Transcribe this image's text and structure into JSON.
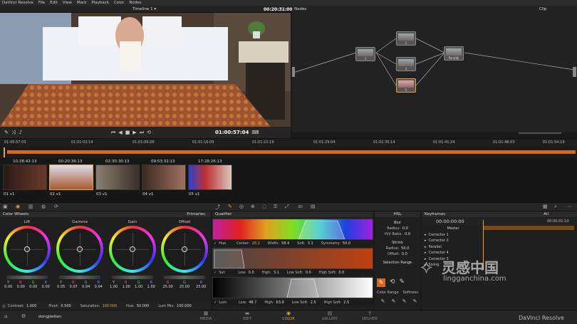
{
  "menu": {
    "app": "DaVinci Resolve",
    "items": [
      "File",
      "Edit",
      "View",
      "Mark",
      "Playback",
      "Color",
      "Nodes"
    ]
  },
  "viewer": {
    "timeline_name": "Timeline 1",
    "timecode_top": "00:20:31:00",
    "timecode_current": "01:00:57:04"
  },
  "nodes": {
    "title": "Nodes",
    "mode": "Clip",
    "node_labels": [
      "1",
      "2",
      "3",
      "4",
      "5"
    ],
    "parallel_label": "Parallel"
  },
  "ruler": {
    "ticks": [
      "01:00:57:03",
      "01:01:03:14",
      "01:01:09:26",
      "01:01:16:09",
      "01:01:22:19",
      "01:01:29:04",
      "01:01:35:14",
      "01:01:41:24",
      "01:01:48:03",
      "01:01:54:19"
    ]
  },
  "clips": [
    {
      "tc": "10:28:42:13",
      "label": "01",
      "track": "v1"
    },
    {
      "tc": "00:20:36:13",
      "label": "02",
      "track": "v1"
    },
    {
      "tc": "02:30:30:13",
      "label": "03",
      "track": "v1"
    },
    {
      "tc": "09:53:32:13",
      "label": "04",
      "track": "v1"
    },
    {
      "tc": "17:28:26:13",
      "label": "05",
      "track": "v1"
    }
  ],
  "color_wheels": {
    "title": "Color Wheels",
    "mode": "Primaries",
    "wheels": [
      {
        "name": "Lift",
        "channels": [
          "Y",
          "R",
          "G",
          "B"
        ],
        "values": [
          "0.00",
          "0.00",
          "0.00",
          "0.00"
        ]
      },
      {
        "name": "Gamma",
        "channels": [
          "Y",
          "R",
          "G",
          "B"
        ],
        "values": [
          "0.05",
          "0.07",
          "0.04",
          "0.04"
        ]
      },
      {
        "name": "Gain",
        "channels": [
          "Y",
          "R",
          "G",
          "B"
        ],
        "values": [
          "1.00",
          "1.00",
          "1.00",
          "1.00"
        ]
      },
      {
        "name": "Offset",
        "channels": [
          "R",
          "G",
          "B"
        ],
        "values": [
          "25.00",
          "25.00",
          "25.00"
        ]
      }
    ],
    "footer": {
      "contrast_label": "Contrast:",
      "contrast_val": "1.000",
      "pivot_label": "Pivot:",
      "pivot_val": "0.500",
      "saturation_label": "Saturation:",
      "saturation_val": "100.000",
      "hue_label": "Hue:",
      "hue_val": "50.000",
      "lummix_label": "Lum Mix:",
      "lummix_val": "100.000"
    }
  },
  "qualifier": {
    "title": "Qualifier",
    "hue": {
      "label": "Hue",
      "center_label": "Center:",
      "center": "28.2",
      "width_label": "Width:",
      "width": "58.4",
      "soft_label": "Soft:",
      "soft": "3.1",
      "sym_label": "Symmetry:",
      "sym": "50.0"
    },
    "sat": {
      "label": "Sat",
      "low_label": "Low:",
      "low": "0.0",
      "high_label": "High:",
      "high": "3.1",
      "lowsoft_label": "Low Soft:",
      "lowsoft": "0.0",
      "highsoft_label": "High Soft:",
      "highsoft": "0.0"
    },
    "lum": {
      "label": "Lum",
      "low_label": "Low:",
      "low": "48.7",
      "high_label": "High:",
      "high": "63.9",
      "lowsoft_label": "Low Soft:",
      "lowsoft": "2.5",
      "highsoft_label": "High Soft:",
      "highsoft": "2.5"
    }
  },
  "hsl": {
    "title": "HSL",
    "blur_title": "Blur",
    "radius_label": "Radius:",
    "radius": "0.0",
    "hv_label": "H/V Ratio:",
    "hv": "0.0",
    "shrink_title": "Shrink",
    "radius2_label": "Radius:",
    "radius2": "50.0",
    "offset_label": "Offset:",
    "offset": "0.0",
    "selection_range": "Selection Range",
    "color_range": "Color Range",
    "softness": "Softness"
  },
  "keyframes": {
    "title": "Keyframes",
    "filter": "All",
    "tc_left": "00:00:00:00",
    "tc_right": "00:00:01:10",
    "rows": [
      "Master",
      "Corrector 1",
      "Corrector 2",
      "Parallel",
      "Corrector 4",
      "Corrector 3",
      "Sizing"
    ]
  },
  "bottom": {
    "user": "dengjiedian",
    "pages": [
      "MEDIA",
      "EDIT",
      "COLOR",
      "GALLERY",
      "DELIVER"
    ],
    "brand": "DaVinci Resolve"
  },
  "watermark": {
    "cn": "灵感中国",
    "url": "lingganchina.com"
  },
  "colors": {
    "accent": "#e8a23c",
    "panel": "#1f1f1f",
    "timeline_orange": "#d9681e"
  }
}
